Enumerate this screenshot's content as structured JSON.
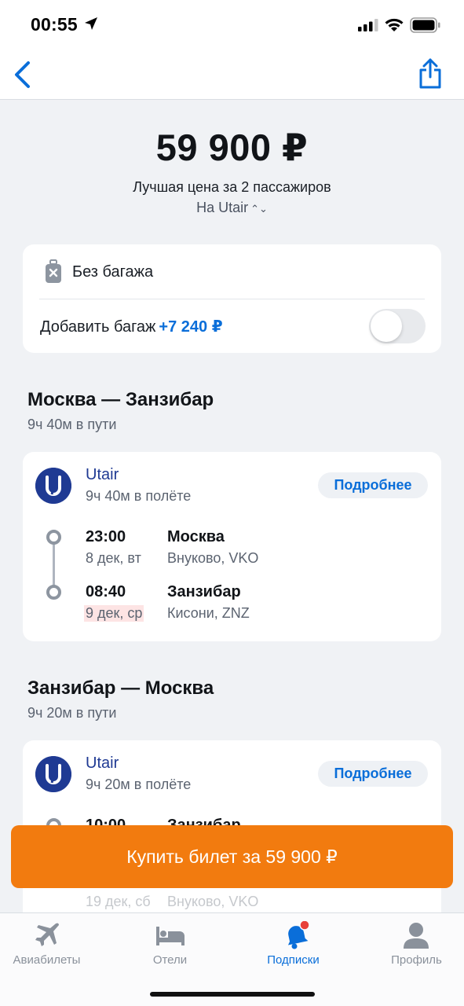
{
  "status_bar": {
    "time": "00:55"
  },
  "header": {
    "price": "59 900 ₽",
    "subtitle": "Лучшая цена за 2 пассажиров",
    "airline_select": "На Utair"
  },
  "baggage": {
    "label": "Без багажа",
    "add_label": "Добавить багаж",
    "add_price": "+7 240 ₽",
    "toggle_on": false
  },
  "routes": [
    {
      "title": "Москва — Занзибар",
      "duration": "9ч 40м в пути",
      "airline": "Utair",
      "flight_duration": "9ч 40м в полёте",
      "details": "Подробнее",
      "departure": {
        "time": "23:00",
        "date": "8 дек, вт",
        "city": "Москва",
        "airport": "Внуково, VKO"
      },
      "arrival": {
        "time": "08:40",
        "date": "9 дек, ср",
        "city": "Занзибар",
        "airport": "Кисони, ZNZ"
      }
    },
    {
      "title": "Занзибар — Москва",
      "duration": "9ч 20м в пути",
      "airline": "Utair",
      "flight_duration": "9ч 20м в полёте",
      "details": "Подробнее",
      "departure": {
        "time": "10:00",
        "city": "Занзибар"
      },
      "arrival": {
        "date": "19 дек, сб",
        "airport": "Внуково, VKO"
      }
    }
  ],
  "buy_button": "Купить билет за 59 900 ₽",
  "tabs": [
    {
      "label": "Авиабилеты",
      "icon": "plane-icon",
      "active": false
    },
    {
      "label": "Отели",
      "icon": "bed-icon",
      "active": false
    },
    {
      "label": "Подписки",
      "icon": "bell-icon",
      "active": true
    },
    {
      "label": "Профиль",
      "icon": "person-icon",
      "active": false
    }
  ],
  "colors": {
    "accent": "#0a6ed9",
    "buy": "#f27b0f",
    "airline": "#1f3a93",
    "notification": "#e8413a"
  }
}
